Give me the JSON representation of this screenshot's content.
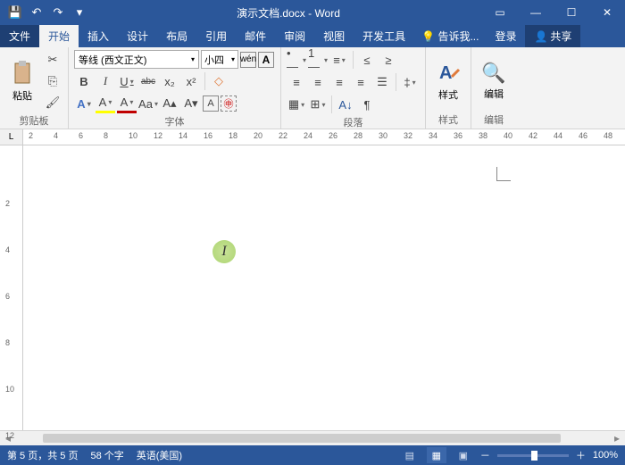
{
  "title": "演示文档.docx - Word",
  "qat": {
    "save": "💾",
    "undo": "↶",
    "redo": "↷",
    "more": "▾"
  },
  "win": {
    "ribbon_opts": "▭",
    "min": "—",
    "max": "☐",
    "close": "✕"
  },
  "tabs": {
    "file": "文件",
    "home": "开始",
    "insert": "插入",
    "design": "设计",
    "layout": "布局",
    "references": "引用",
    "mail": "邮件",
    "review": "审阅",
    "view": "视图",
    "dev": "开发工具",
    "tell": "告诉我...",
    "signin": "登录",
    "share": "共享"
  },
  "clipboard": {
    "paste": "粘贴",
    "label": "剪贴板",
    "cut": "✂",
    "copy": "⎘",
    "brush": "🖌"
  },
  "font": {
    "name": "等线 (西文正文)",
    "size": "小四",
    "wen": "wén",
    "a": "A",
    "bold": "B",
    "italic": "I",
    "underline": "U",
    "strike": "abc",
    "sub": "x₂",
    "sup": "x²",
    "grow": "A▴",
    "shrink": "A▾",
    "case": "Aa",
    "clear": "◇",
    "color_a": "A",
    "highlight_a": "A",
    "effects_a": "A",
    "label": "字体"
  },
  "para": {
    "bullets": "•—",
    "numbers": "1—",
    "multilevel": "≡",
    "dec_indent": "≤",
    "inc_indent": "≥",
    "align_l": "≡",
    "align_c": "≡",
    "align_r": "≡",
    "align_j": "≡",
    "dist": "☰",
    "line_spacing": "‡",
    "shading": "▦",
    "borders": "⊞",
    "sort": "A↓",
    "marks": "¶",
    "label": "段落"
  },
  "styles": {
    "btn": "A",
    "label": "样式"
  },
  "editing": {
    "find": "🔍",
    "label": "编辑"
  },
  "ruler_h": [
    2,
    4,
    6,
    8,
    10,
    12,
    14,
    16,
    18,
    20,
    22,
    24,
    26,
    28,
    30,
    32,
    34,
    36,
    38,
    40,
    42,
    44,
    46,
    48
  ],
  "ruler_v": [
    2,
    4,
    6,
    8,
    10,
    12
  ],
  "status": {
    "page": "第 5 页，共 5 页",
    "words": "58 个字",
    "lang": "英语(美国)",
    "zoom": "100%",
    "zoom_out": "－",
    "zoom_in": "＋"
  }
}
